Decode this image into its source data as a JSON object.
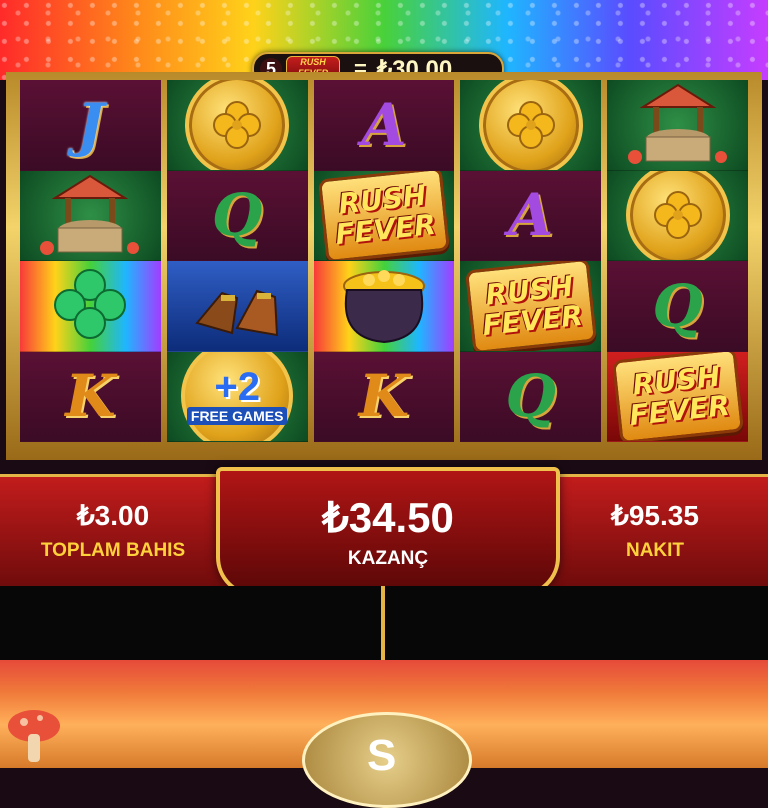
{
  "win_banner": {
    "count": "5",
    "logo_line1": "RUSH",
    "logo_line2": "FEVER",
    "equals": "=",
    "amount": "₺30.00"
  },
  "reels": [
    [
      {
        "type": "letter",
        "text": "J",
        "cls": "l-j",
        "bg": "maroon",
        "name": "symbol-j"
      },
      {
        "type": "well",
        "bg": "green",
        "name": "wishing-well-symbol"
      },
      {
        "type": "clover",
        "bg": "rainbow",
        "name": "clover-symbol"
      },
      {
        "type": "letter",
        "text": "K",
        "cls": "l-k",
        "bg": "maroon",
        "name": "symbol-k"
      }
    ],
    [
      {
        "type": "coin",
        "bg": "green",
        "name": "gold-coin-symbol"
      },
      {
        "type": "letter",
        "text": "Q",
        "cls": "l-q",
        "bg": "maroon",
        "name": "symbol-q"
      },
      {
        "type": "boots",
        "bg": "blue",
        "name": "boots-symbol"
      },
      {
        "type": "free",
        "bg": "green",
        "name": "free-games-coin",
        "plus": "+2",
        "label": "FREE GAMES"
      }
    ],
    [
      {
        "type": "letter",
        "text": "A",
        "cls": "l-a",
        "bg": "maroon",
        "name": "symbol-a"
      },
      {
        "type": "logo",
        "bg": "green",
        "name": "rush-fever-symbol",
        "l1": "RUSH",
        "l2": "FEVER"
      },
      {
        "type": "pot",
        "bg": "rainbow",
        "name": "pot-of-gold-symbol"
      },
      {
        "type": "letter",
        "text": "K",
        "cls": "l-k",
        "bg": "maroon",
        "name": "symbol-k"
      }
    ],
    [
      {
        "type": "coin",
        "bg": "green",
        "name": "gold-coin-symbol"
      },
      {
        "type": "letter",
        "text": "A",
        "cls": "l-a",
        "bg": "maroon",
        "name": "symbol-a"
      },
      {
        "type": "logo",
        "bg": "green",
        "name": "rush-fever-symbol",
        "l1": "RUSH",
        "l2": "FEVER"
      },
      {
        "type": "letter",
        "text": "Q",
        "cls": "l-q",
        "bg": "maroon",
        "name": "symbol-q"
      }
    ],
    [
      {
        "type": "well",
        "bg": "green",
        "name": "wishing-well-symbol"
      },
      {
        "type": "coin",
        "bg": "green",
        "name": "gold-coin-symbol"
      },
      {
        "type": "letter",
        "text": "Q",
        "cls": "l-q",
        "bg": "maroon",
        "name": "symbol-q"
      },
      {
        "type": "logo",
        "bg": "red",
        "name": "rush-fever-symbol",
        "l1": "RUSH",
        "l2": "FEVER"
      }
    ]
  ],
  "hud": {
    "total_bet": {
      "amount": "₺3.00",
      "label": "TOPLAM BAHIS"
    },
    "win": {
      "amount": "₺34.50",
      "label": "KAZANÇ"
    },
    "cash": {
      "amount": "₺95.35",
      "label": "NAKIT"
    }
  },
  "spin_button": {
    "glyph": "S"
  },
  "colors": {
    "gold": "#e5b446",
    "hud_red": "#c21c1c",
    "label_yellow": "#ffd23c"
  }
}
